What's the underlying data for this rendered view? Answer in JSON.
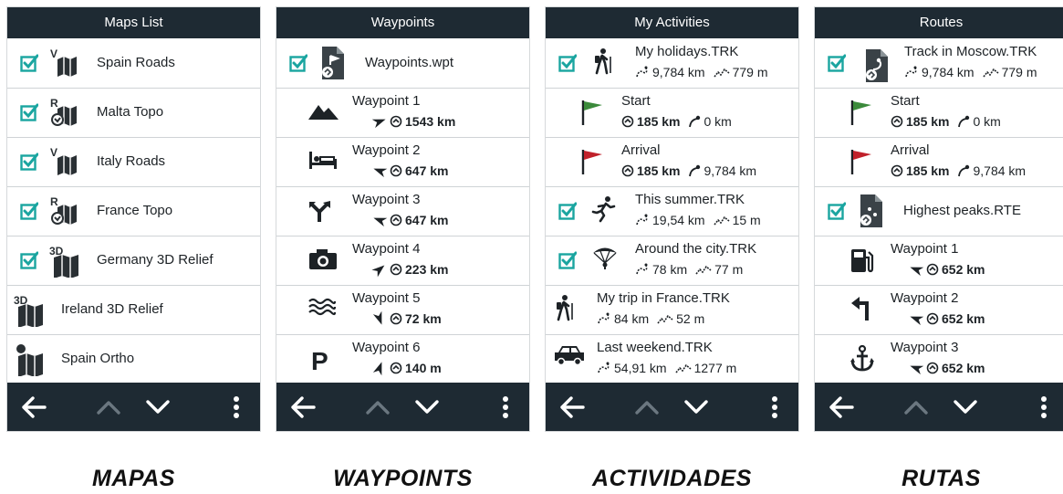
{
  "panels": {
    "maps": {
      "title": "Maps List",
      "caption": "MAPAS",
      "items": [
        {
          "name": "Spain Roads",
          "checked": true,
          "icon": "vector-map-icon",
          "badge": "V"
        },
        {
          "name": "Malta Topo",
          "checked": true,
          "icon": "raster-map-icon",
          "badge": "R"
        },
        {
          "name": "Italy Roads",
          "checked": true,
          "icon": "vector-map-icon",
          "badge": "V"
        },
        {
          "name": "France Topo",
          "checked": true,
          "icon": "raster-map-icon",
          "badge": "R"
        },
        {
          "name": "Germany 3D Relief",
          "checked": true,
          "icon": "relief-3d-map-icon",
          "badge": "3D"
        },
        {
          "name": "Ireland 3D Relief",
          "checked": false,
          "icon": "relief-3d-map-icon",
          "badge": "3D"
        },
        {
          "name": "Spain Ortho",
          "checked": false,
          "icon": "ortho-map-icon",
          "badge": ""
        }
      ]
    },
    "waypoints": {
      "title": "Waypoints",
      "caption": "WAYPOINTS",
      "file": {
        "name": "Waypoints.wpt",
        "checked": true,
        "icon": "waypoint-file-icon"
      },
      "items": [
        {
          "name": "Waypoint 1",
          "icon": "mountain-icon",
          "distance": "1543 km"
        },
        {
          "name": "Waypoint 2",
          "icon": "bed-icon",
          "distance": "647 km"
        },
        {
          "name": "Waypoint 3",
          "icon": "fork-icon",
          "distance": "647 km"
        },
        {
          "name": "Waypoint 4",
          "icon": "camera-icon",
          "distance": "223 km"
        },
        {
          "name": "Waypoint 5",
          "icon": "water-icon",
          "distance": "72 km"
        },
        {
          "name": "Waypoint 6",
          "icon": "parking-icon",
          "distance": "140 m"
        }
      ]
    },
    "activities": {
      "title": "My Activities",
      "caption": "ACTIVIDADES",
      "items": [
        {
          "kind": "track",
          "name": "My holidays.TRK",
          "checked": true,
          "icon": "hiker-icon",
          "length": "9,784 km",
          "elevation": "779 m"
        },
        {
          "kind": "point",
          "name": "Start",
          "icon": "start-flag-icon",
          "distance": "185 km",
          "along": "0 km"
        },
        {
          "kind": "point",
          "name": "Arrival",
          "icon": "arrival-flag-icon",
          "distance": "185 km",
          "along": "9,784 km"
        },
        {
          "kind": "track",
          "name": "This summer.TRK",
          "checked": true,
          "icon": "runner-icon",
          "length": "19,54 km",
          "elevation": "15 m"
        },
        {
          "kind": "track",
          "name": "Around the city.TRK",
          "checked": true,
          "icon": "paraglider-icon",
          "length": "78 km",
          "elevation": "77 m"
        },
        {
          "kind": "track",
          "name": "My trip in France.TRK",
          "checked": false,
          "icon": "hiker-icon",
          "length": "84 km",
          "elevation": "52 m"
        },
        {
          "kind": "track",
          "name": "Last weekend.TRK",
          "checked": false,
          "icon": "car-icon",
          "length": "54,91 km",
          "elevation": "1277 m"
        }
      ]
    },
    "routes": {
      "title": "Routes",
      "caption": "RUTAS",
      "items": [
        {
          "kind": "track",
          "name": "Track in Moscow.TRK",
          "checked": true,
          "icon": "track-file-icon",
          "length": "9,784 km",
          "elevation": "779 m"
        },
        {
          "kind": "point",
          "name": "Start",
          "icon": "start-flag-icon",
          "distance": "185 km",
          "along": "0 km"
        },
        {
          "kind": "point",
          "name": "Arrival",
          "icon": "arrival-flag-icon",
          "distance": "185 km",
          "along": "9,784 km"
        },
        {
          "kind": "route",
          "name": "Highest peaks.RTE",
          "checked": true,
          "icon": "route-file-icon"
        },
        {
          "kind": "wp",
          "name": "Waypoint 1",
          "icon": "fuel-icon",
          "distance": "652 km"
        },
        {
          "kind": "wp",
          "name": "Waypoint 2",
          "icon": "turn-left-icon",
          "distance": "652 km"
        },
        {
          "kind": "wp",
          "name": "Waypoint 3",
          "icon": "anchor-icon",
          "distance": "652 km"
        }
      ]
    }
  },
  "colors": {
    "header": "#1e2a33",
    "accent": "#1aa5a0",
    "start_flag": "#3b8a3b",
    "arrival_flag": "#c0212b"
  }
}
